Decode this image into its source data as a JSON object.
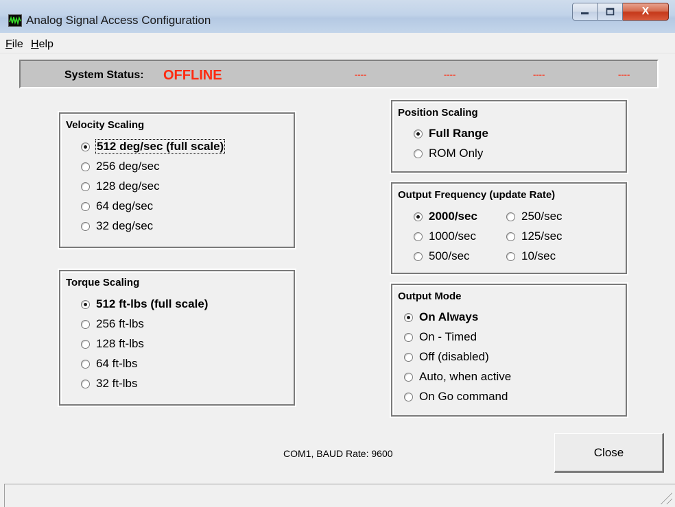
{
  "window": {
    "title": "Analog Signal Access Configuration",
    "minimize_glyph": "—",
    "maximize_glyph": "▢",
    "close_glyph": "X"
  },
  "menu": {
    "file": "File",
    "help": "Help"
  },
  "status": {
    "label": "System Status:",
    "value": "OFFLINE",
    "indicators": [
      "----",
      "----",
      "----",
      "----"
    ],
    "color": "#ff2a10"
  },
  "velocity": {
    "title": "Velocity Scaling",
    "options": [
      "512 deg/sec (full scale)",
      "256 deg/sec",
      "128 deg/sec",
      "64 deg/sec",
      "32 deg/sec"
    ],
    "selected": 0
  },
  "torque": {
    "title": "Torque Scaling",
    "options": [
      "512 ft-lbs (full scale)",
      "256 ft-lbs",
      "128 ft-lbs",
      "64 ft-lbs",
      "32 ft-lbs"
    ],
    "selected": 0
  },
  "position": {
    "title": "Position Scaling",
    "options": [
      "Full Range",
      "ROM Only"
    ],
    "selected": 0
  },
  "frequency": {
    "title": "Output Frequency (update Rate)",
    "options": [
      "2000/sec",
      "1000/sec",
      "500/sec",
      "250/sec",
      "125/sec",
      "10/sec"
    ],
    "selected": 0
  },
  "output_mode": {
    "title": "Output Mode",
    "options": [
      "On Always",
      "On - Timed",
      "Off (disabled)",
      "Auto, when active",
      "On Go command"
    ],
    "selected": 0
  },
  "footer": {
    "com_info": "COM1,  BAUD Rate: 9600",
    "close_label": "Close"
  }
}
